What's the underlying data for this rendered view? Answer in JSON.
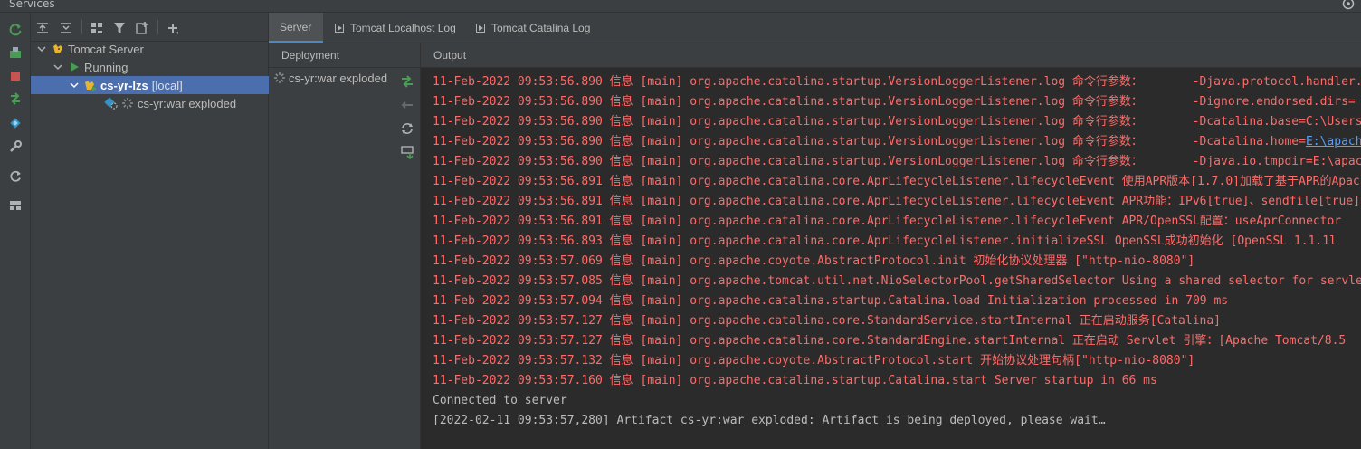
{
  "window": {
    "title": "Services"
  },
  "left_toolbar": {
    "icons": [
      "rerun-icon",
      "deploy-icon",
      "stop-icon",
      "redeploy-icon",
      "artifact-icon",
      "wrench-icon",
      "refresh-icon",
      "layout-icon"
    ]
  },
  "tree": {
    "nodes": [
      {
        "label": "Tomcat Server",
        "depth": 0,
        "expanded": true
      },
      {
        "label": "Running",
        "depth": 1,
        "expanded": true
      },
      {
        "label": "cs-yr-lzs",
        "suffix": "[local]",
        "depth": 2,
        "expanded": true,
        "selected": true
      },
      {
        "label": "cs-yr:war exploded",
        "depth": 3
      }
    ]
  },
  "tabs": [
    {
      "label": "Server",
      "active": true
    },
    {
      "label": "Tomcat Localhost Log",
      "active": false
    },
    {
      "label": "Tomcat Catalina Log",
      "active": false
    }
  ],
  "deployment": {
    "header": "Deployment",
    "item": "cs-yr:war exploded"
  },
  "output": {
    "header": "Output",
    "lines": [
      {
        "text": "11-Feb-2022 09:53:56.890 信息 [main] org.apache.catalina.startup.VersionLoggerListener.log 命令行参数：       -Djava.protocol.handler.pkgs=org.apache.catalina.webresources",
        "kind": "err"
      },
      {
        "text": "11-Feb-2022 09:53:56.890 信息 [main] org.apache.catalina.startup.VersionLoggerListener.log 命令行参数：       -Dignore.endorsed.dirs=",
        "kind": "err"
      },
      {
        "text": "11-Feb-2022 09:53:56.890 信息 [main] org.apache.catalina.startup.VersionLoggerListener.log 命令行参数：       -Dcatalina.base=C:\\Users",
        "kind": "err"
      },
      {
        "text_pre": "11-Feb-2022 09:53:56.890 信息 [main] org.apache.catalina.startup.VersionLoggerListener.log 命令行参数：       -Dcatalina.home=",
        "link": "E:\\apache",
        "kind": "link"
      },
      {
        "text": "11-Feb-2022 09:53:56.890 信息 [main] org.apache.catalina.startup.VersionLoggerListener.log 命令行参数：       -Djava.io.tmpdir=E:\\apache",
        "kind": "err"
      },
      {
        "text": "11-Feb-2022 09:53:56.891 信息 [main] org.apache.catalina.core.AprLifecycleListener.lifecycleEvent 使用APR版本[1.7.0]加载了基于APR的Apache",
        "kind": "err"
      },
      {
        "text": "11-Feb-2022 09:53:56.891 信息 [main] org.apache.catalina.core.AprLifecycleListener.lifecycleEvent APR功能：IPv6[true]、sendfile[true]",
        "kind": "err"
      },
      {
        "text": "11-Feb-2022 09:53:56.891 信息 [main] org.apache.catalina.core.AprLifecycleListener.lifecycleEvent APR/OpenSSL配置：useAprConnector",
        "kind": "err"
      },
      {
        "text": "11-Feb-2022 09:53:56.893 信息 [main] org.apache.catalina.core.AprLifecycleListener.initializeSSL OpenSSL成功初始化 [OpenSSL 1.1.1l",
        "kind": "err"
      },
      {
        "text": "11-Feb-2022 09:53:57.069 信息 [main] org.apache.coyote.AbstractProtocol.init 初始化协议处理器 [\"http-nio-8080\"]",
        "kind": "err"
      },
      {
        "text": "11-Feb-2022 09:53:57.085 信息 [main] org.apache.tomcat.util.net.NioSelectorPool.getSharedSelector Using a shared selector for servlet",
        "kind": "err"
      },
      {
        "text": "11-Feb-2022 09:53:57.094 信息 [main] org.apache.catalina.startup.Catalina.load Initialization processed in 709 ms",
        "kind": "err"
      },
      {
        "text": "11-Feb-2022 09:53:57.127 信息 [main] org.apache.catalina.core.StandardService.startInternal 正在启动服务[Catalina]",
        "kind": "err"
      },
      {
        "text": "11-Feb-2022 09:53:57.127 信息 [main] org.apache.catalina.core.StandardEngine.startInternal 正在启动 Servlet 引擎：[Apache Tomcat/8.5",
        "kind": "err"
      },
      {
        "text": "11-Feb-2022 09:53:57.132 信息 [main] org.apache.coyote.AbstractProtocol.start 开始协议处理句柄[\"http-nio-8080\"]",
        "kind": "err"
      },
      {
        "text": "11-Feb-2022 09:53:57.160 信息 [main] org.apache.catalina.startup.Catalina.start Server startup in 66 ms",
        "kind": "err"
      },
      {
        "text": "Connected to server",
        "kind": "norm"
      },
      {
        "text": "[2022-02-11 09:53:57,280] Artifact cs-yr:war exploded: Artifact is being deployed, please wait…",
        "kind": "norm"
      }
    ]
  },
  "colors": {
    "background": "#2b2b2b",
    "panel": "#3c3f41",
    "selection": "#4b6eaf",
    "log_error": "#ff6b68",
    "log_normal": "#bbbbbb",
    "link": "#589df6",
    "run_green": "#499c54",
    "stop_red": "#c75450"
  }
}
